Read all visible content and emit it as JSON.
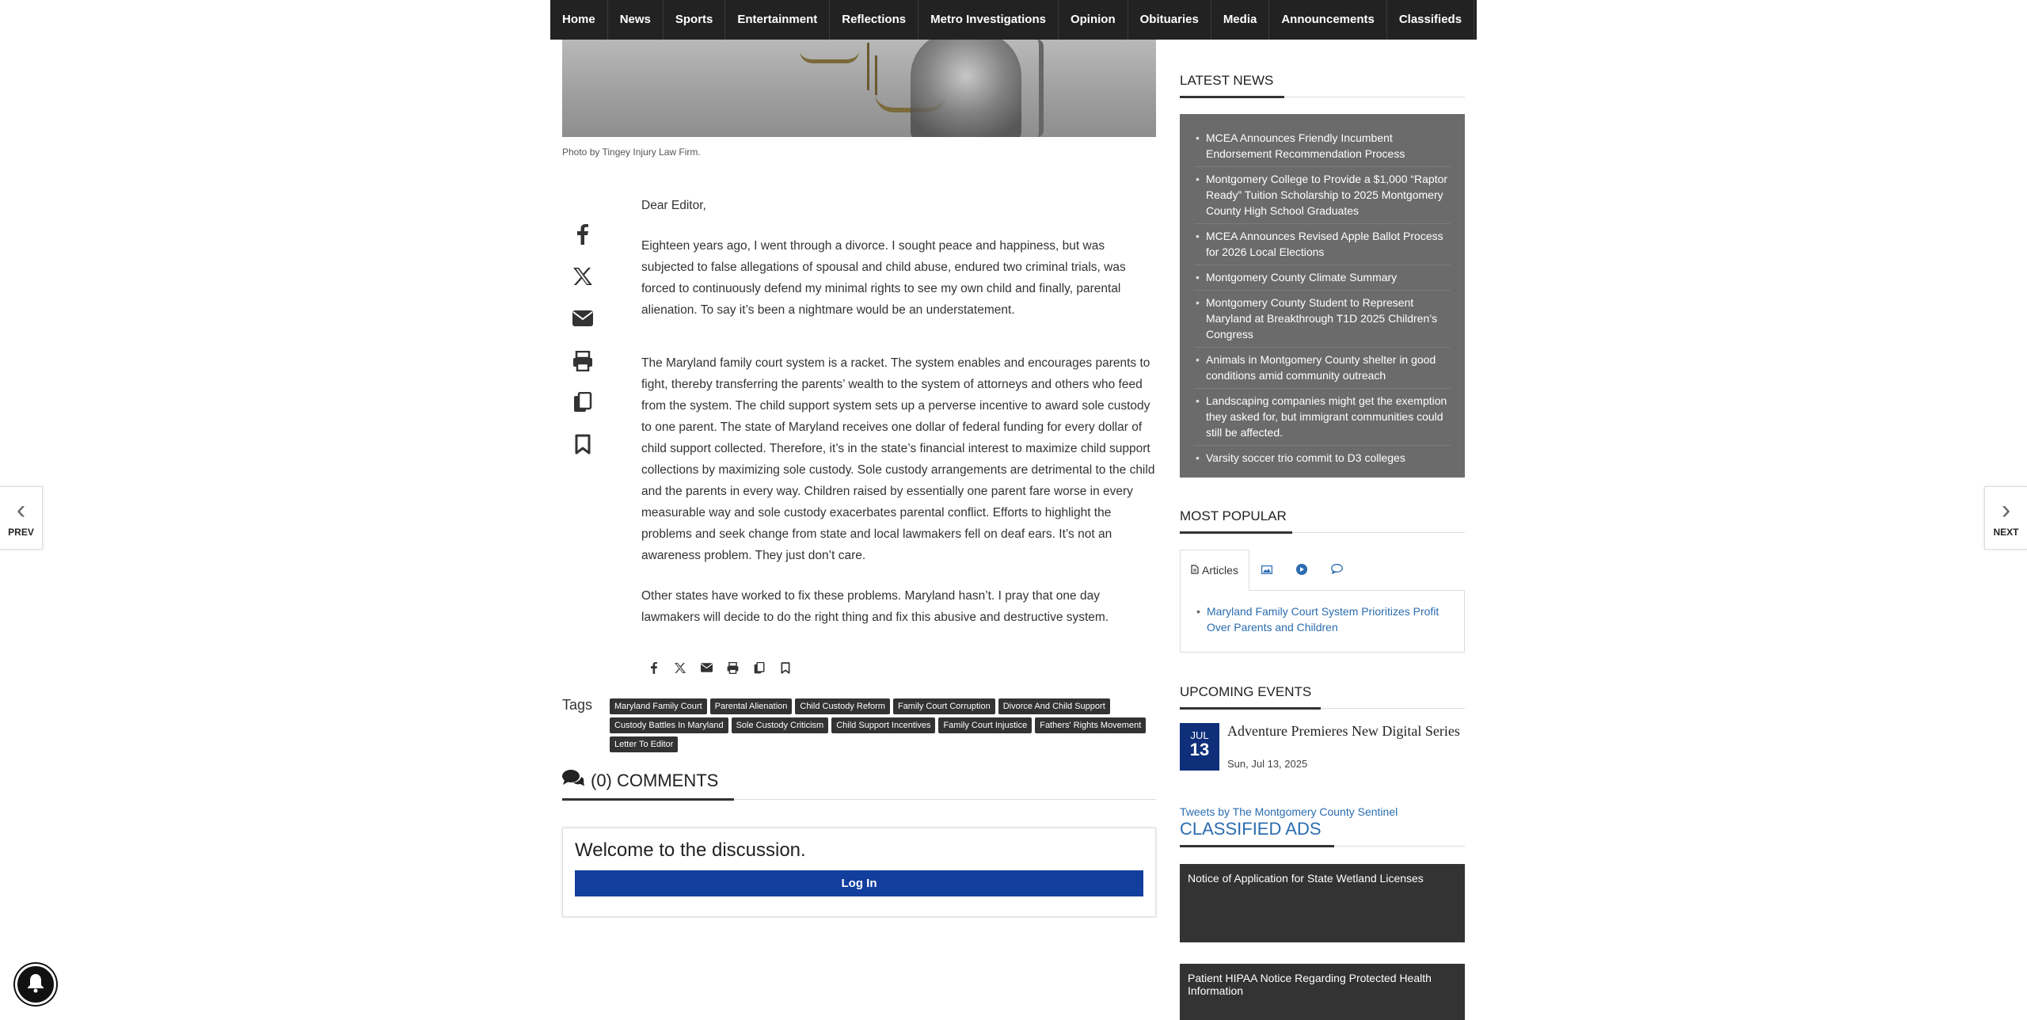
{
  "nav": {
    "items": [
      "Home",
      "News",
      "Sports",
      "Entertainment",
      "Reflections",
      "Metro Investigations",
      "Opinion",
      "Obituaries",
      "Media",
      "Announcements",
      "Classifieds"
    ]
  },
  "photo": {
    "caption": "Photo by Tingey Injury Law Firm."
  },
  "article": {
    "salutation": "Dear Editor,",
    "paragraphs": [
      "Eighteen years ago, I went through a divorce. I sought peace and happiness, but was subjected to false allegations of spousal and child abuse, endured two criminal trials, was forced to continuously defend my minimal rights to see my own child and finally, parental alienation. To say it’s been a nightmare would be an understatement.",
      "The Maryland family court system is a racket. The system enables and encourages parents to fight, thereby transferring the parents’ wealth to the system of attorneys and others who feed from the system. The child support system sets up a perverse incentive to award sole custody to one parent. The state of Maryland receives one dollar of federal funding for every dollar of child support collected. Therefore, it’s in the state’s financial interest to maximize child support collections by maximizing sole custody. Sole custody arrangements are detrimental to the child and the parents in every way. Children raised by essentially one parent fare worse in every measurable way and sole custody exacerbates parental conflict. Efforts to highlight the problems and seek change from state and local lawmakers fell on deaf ears. It’s not an awareness problem. They just don’t care.",
      "Other states have worked to fix these problems. Maryland hasn’t. I pray that one day lawmakers will decide to do the right thing and fix this abusive and destructive system."
    ]
  },
  "share": {
    "icons": [
      "facebook-icon",
      "x-twitter-icon",
      "email-icon",
      "print-icon",
      "copy-icon",
      "bookmark-icon"
    ]
  },
  "tags": {
    "label": "Tags",
    "items": [
      "Maryland Family Court",
      "Parental Alienation",
      "Child Custody Reform",
      "Family Court Corruption",
      "Divorce And Child Support",
      "Custody Battles In Maryland",
      "Sole Custody Criticism",
      "Child Support Incentives",
      "Family Court Injustice",
      "Fathers' Rights Movement",
      "Letter To Editor"
    ]
  },
  "comments": {
    "heading": "(0) COMMENTS",
    "welcome": "Welcome to the discussion.",
    "login_label": "Log In"
  },
  "sidebar": {
    "latest_news": {
      "heading": "LATEST NEWS",
      "items": [
        "MCEA Announces Friendly Incumbent Endorsement Recommendation Process",
        "Montgomery College to Provide a $1,000 “Raptor Ready” Tuition Scholarship to 2025 Montgomery County High School Graduates",
        "MCEA Announces Revised Apple Ballot Process for 2026 Local Elections",
        "Montgomery County Climate Summary",
        "Montgomery County Student to Represent Maryland at Breakthrough T1D 2025 Children’s Congress",
        "Animals in Montgomery County shelter in good conditions amid community outreach",
        "Landscaping companies might get the exemption they asked for, but immigrant communities could still be affected.",
        "Varsity soccer trio commit to D3 colleges"
      ]
    },
    "most_popular": {
      "heading": "MOST POPULAR",
      "tab_articles": "Articles",
      "items": [
        "Maryland Family Court System Prioritizes Profit Over Parents and Children"
      ]
    },
    "upcoming_events": {
      "heading": "UPCOMING EVENTS",
      "month": "JUL",
      "day": "13",
      "title": "Adventure Premieres New Digital Series",
      "time": "Sun, Jul 13, 2025"
    },
    "tweets_link": "Tweets by The Montgomery County Sentinel",
    "classified": {
      "heading": "CLASSIFIED ADS",
      "items": [
        "Notice of Application for State Wetland Licenses",
        "Patient HIPAA Notice Regarding Protected Health Information"
      ]
    }
  },
  "pager": {
    "prev": "PREV",
    "next": "NEXT"
  },
  "colors": {
    "nav_bg": "#222222",
    "latest_bg": "#6b6b6b",
    "login_btn": "#123e9e",
    "link": "#2a6cb0",
    "event_date_bg": "#0f2f7a"
  }
}
